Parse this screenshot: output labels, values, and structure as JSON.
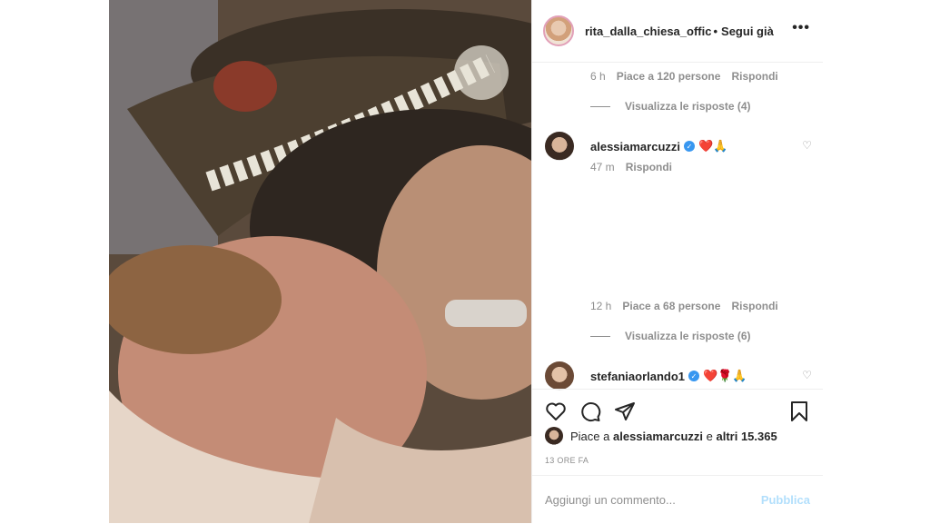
{
  "header": {
    "username": "rita_dalla_chiesa_offic",
    "separator": "•",
    "follow_status": "Segui già",
    "more": "•••"
  },
  "thread": {
    "first_meta": {
      "time": "6 h",
      "likes": "Piace a 120 persone",
      "reply": "Rispondi"
    },
    "first_replies": "Visualizza le risposte (4)",
    "comment1": {
      "username": "alessiamarcuzzi",
      "verified": "✓",
      "text": "❤️🙏",
      "time": "47 m",
      "reply": "Rispondi"
    },
    "second_meta": {
      "time": "12 h",
      "likes": "Piace a 68 persone",
      "reply": "Rispondi"
    },
    "second_replies": "Visualizza le risposte (6)",
    "comment2": {
      "username": "stefaniaorlando1",
      "verified": "✓",
      "text": "❤️🌹🙏"
    }
  },
  "icons": [
    "like-icon",
    "comment-icon",
    "share-icon",
    "save-icon"
  ],
  "likes": {
    "prefix": "Piace a",
    "user": "alessiamarcuzzi",
    "middle": "e",
    "others": "altri 15.365"
  },
  "timestamp": "13 ORE FA",
  "add_comment": {
    "placeholder": "Aggiungi un commento...",
    "publish": "Pubblica"
  }
}
